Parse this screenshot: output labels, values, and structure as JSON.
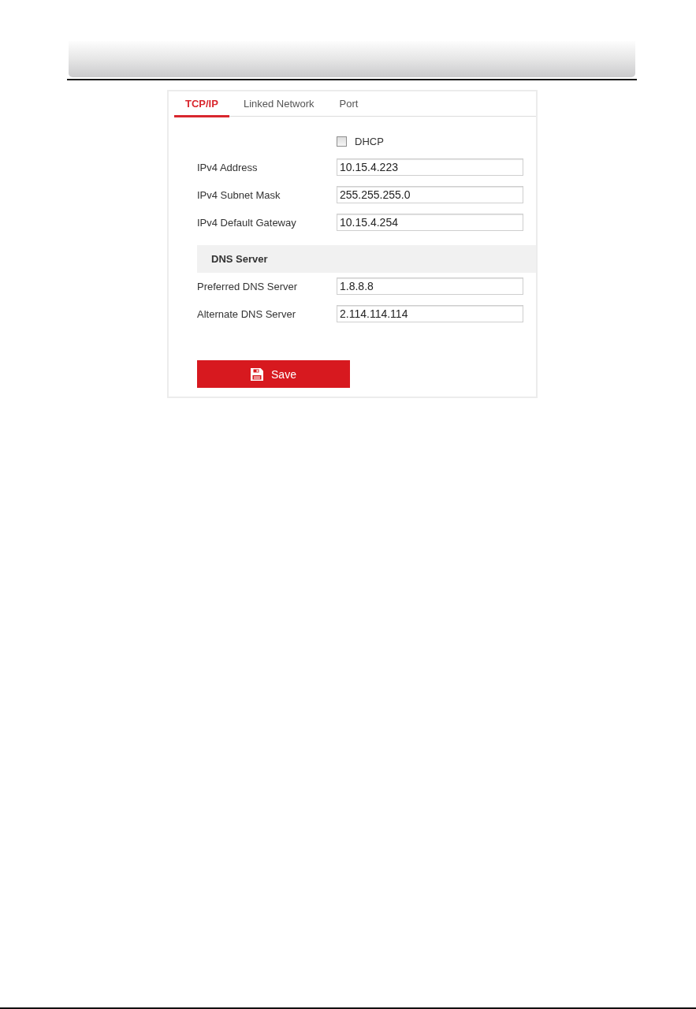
{
  "tabs": [
    {
      "label": "TCP/IP",
      "selected": true
    },
    {
      "label": "Linked Network",
      "selected": false
    },
    {
      "label": "Port",
      "selected": false
    }
  ],
  "dhcp": {
    "label": "DHCP",
    "checked": false
  },
  "ipv4_fields": [
    {
      "label": "IPv4 Address",
      "value": "10.15.4.223"
    },
    {
      "label": "IPv4 Subnet Mask",
      "value": "255.255.255.0"
    },
    {
      "label": "IPv4 Default Gateway",
      "value": "10.15.4.254"
    }
  ],
  "dns_server": {
    "title": "DNS Server",
    "fields": [
      {
        "label": "Preferred DNS Server",
        "value": "1.8.8.8"
      },
      {
        "label": "Alternate DNS Server",
        "value": "2.114.114.114"
      }
    ]
  },
  "save_button": {
    "label": "Save"
  }
}
